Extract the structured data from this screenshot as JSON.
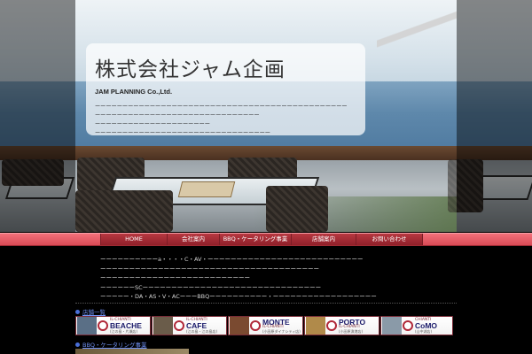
{
  "hero": {
    "company_name": "株式会社ジャム企画",
    "company_name_en": "JAM PLANNING Co.,Ltd.",
    "description_lines": [
      "ーーーーーーーーーーーーーーーーーーーーーーーーーーーーーーーーーーーーーーーーーーーーーー",
      "ーーーーーーーーーーーーーーーーーーーーーーーーーーーーーー",
      "ーーーーーーーーーーーーーーーーーーーーー",
      "ーーーーーーーーーーーーーーーーーーーーーーーーーーーーーーーー"
    ]
  },
  "nav": {
    "items": [
      {
        "label": "HOME"
      },
      {
        "label": "会社案内"
      },
      {
        "label": "BBQ・ケータリング事業"
      },
      {
        "label": "店舗案内"
      },
      {
        "label": "お問い合わせ"
      }
    ]
  },
  "intro": {
    "lines": [
      "ーーーーーーーーーーa・・・・C・AV・ーーーーーーーーーーーーーーーーーーーーーーーーーーー",
      "ーーーーーーーーーーーーーーーーーーーーーーーーーーーーーーーーーーーーーー",
      "ーーーーーーーーーーーーーーーーーーーーーーーーーー",
      "ーーーーーーSCーーーーーーーーーーーーーーーーーーーーーーーーーーーーーーー",
      "ーーーーー・DA・AS・V・ACーーーBBQーーーーーーーーーー・ーーーーーーーーーーーーーーーーーー"
    ]
  },
  "sections": {
    "shops": {
      "title": "店舗一覧"
    },
    "bbq": {
      "title": "BBQ・ケータリング事業"
    }
  },
  "banners": [
    {
      "small": "IL-CHIANTI",
      "big": "BEACHE",
      "tiny": "(江の島・片瀬店)",
      "big_color": "#1a1a6a",
      "thumb_color": "#5a6f86"
    },
    {
      "small": "IL-CHIANTI",
      "big": "CAFE",
      "tiny": "(江の島・江の島店)",
      "big_color": "#1a1a6a",
      "thumb_color": "#6a5c4a"
    },
    {
      "small": "MONTE",
      "big": "IL-CHIANTI",
      "tiny": "(小田原ダイナシティ店)",
      "big_color": "#1a1a6a",
      "thumb_color": "#7a4a30"
    },
    {
      "small": "IL-CHIANTI",
      "big": "PORTO",
      "tiny": "(小田原漁港店)",
      "big_color": "#1a1a6a",
      "thumb_color": "#b08a4a"
    },
    {
      "small": "CHIANTI",
      "big": "CoMO",
      "tiny": "(山中湖店)",
      "big_color": "#1a1a6a",
      "thumb_color": "#8a9aa8"
    }
  ],
  "colors": {
    "nav_accent": "#d94b56",
    "link": "#6f8ff0",
    "banner_border": "#7a2a36"
  }
}
